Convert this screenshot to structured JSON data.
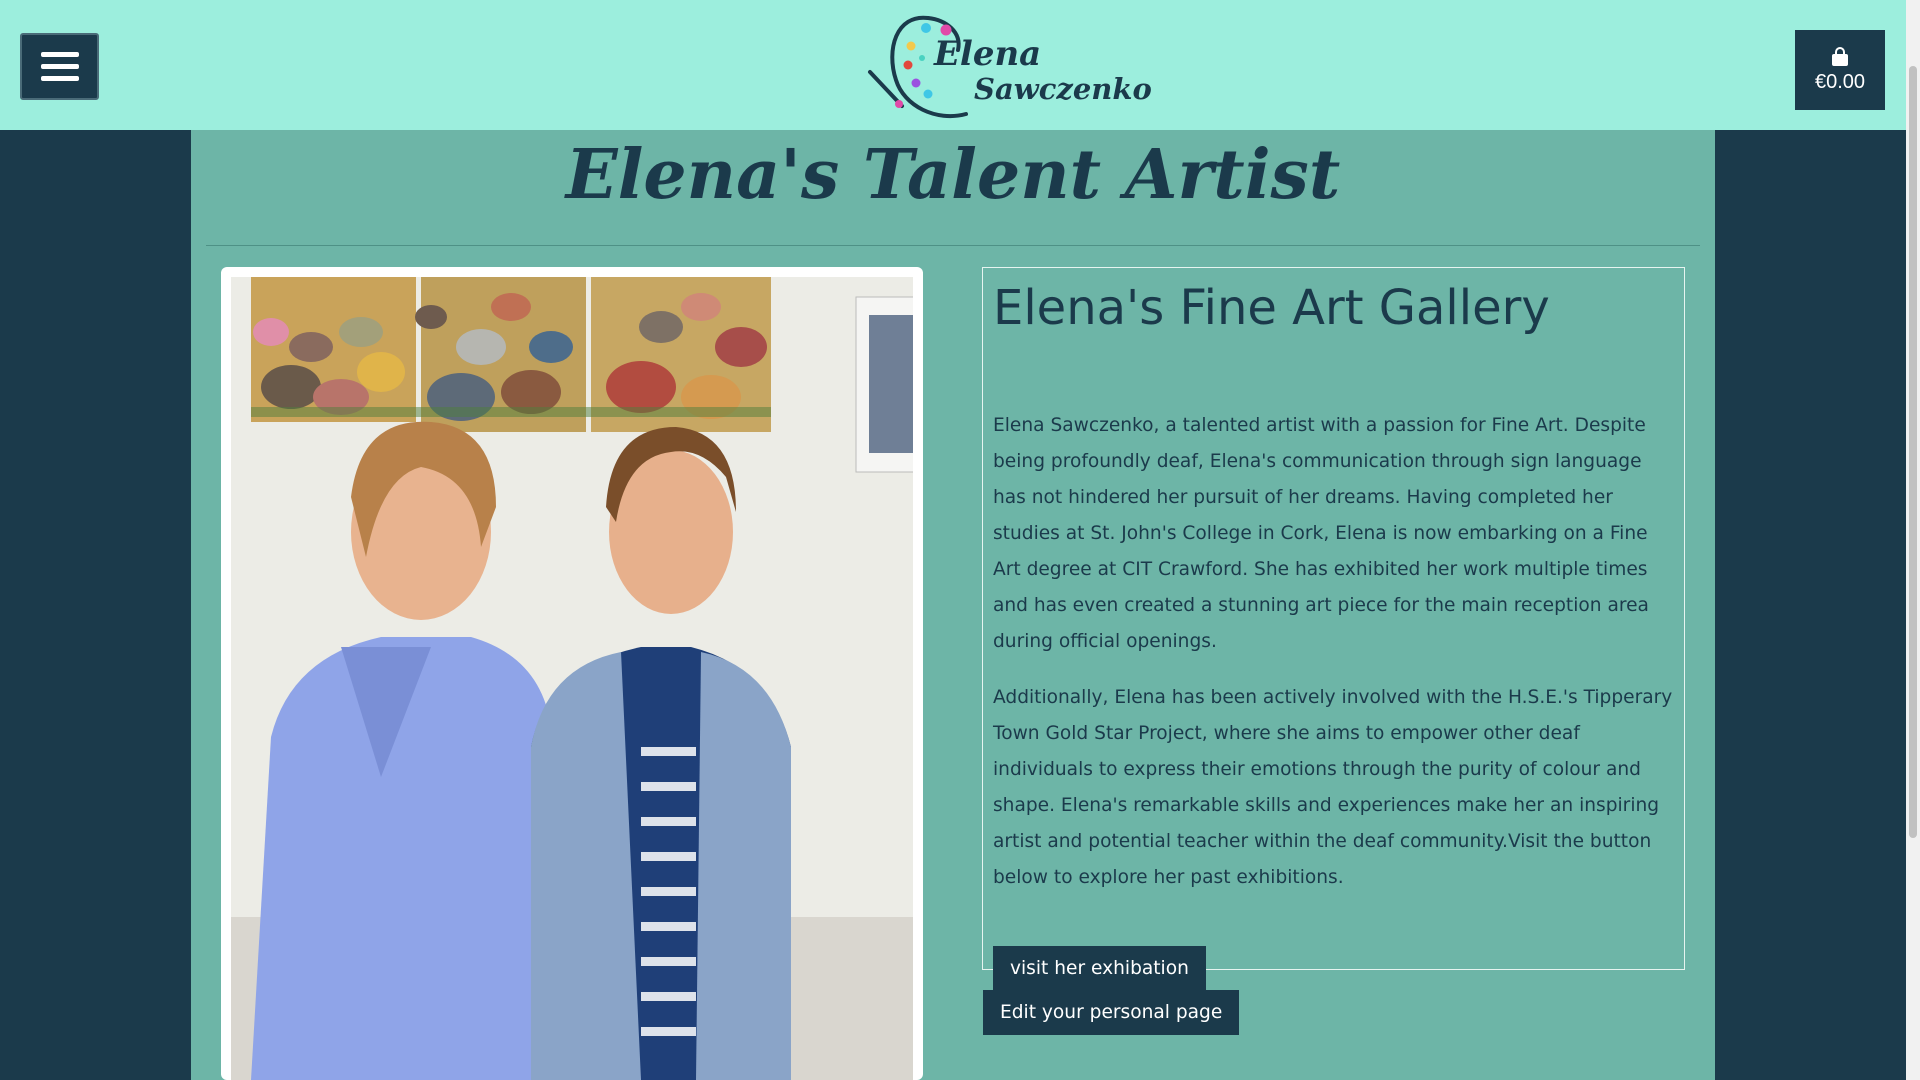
{
  "header": {
    "menu_icon": "hamburger-menu-icon",
    "logo": {
      "line1": "Elena",
      "line2": "Sawczenko",
      "icon": "palette-brush-icon"
    },
    "cart": {
      "icon": "shopping-bag-icon",
      "amount": "€0.00"
    }
  },
  "main": {
    "title": "Elena's Talent Artist",
    "photo_alt": "Elena and another woman standing in front of stone paintings",
    "gallery": {
      "heading": "Elena's Fine Art Gallery",
      "paragraph1": "Elena Sawczenko, a talented artist with a passion for Fine Art. Despite being profoundly deaf, Elena's communication through sign language has not hindered her pursuit of her dreams. Having completed her studies at St. John's College in Cork, Elena is now embarking on a Fine Art degree at CIT Crawford. She has exhibited her work multiple times and has even created a stunning art piece for the main reception area during official openings.",
      "paragraph2": "Additionally, Elena has been actively involved with the H.S.E.'s Tipperary Town Gold Star Project, where she aims to empower other deaf individuals to express their emotions through the purity of colour and shape. Elena's remarkable skills and experiences make her an inspiring artist and potential teacher within the deaf community.Visit the button below to explore her past exhibitions.",
      "visit_button": "visit her exhibation"
    },
    "edit_button": "Edit your personal page"
  },
  "colors": {
    "header_bg": "#9ceedd",
    "page_bg": "#1b3a4b",
    "panel_bg": "#6db5a7",
    "accent_dark": "#1b3a4b"
  }
}
